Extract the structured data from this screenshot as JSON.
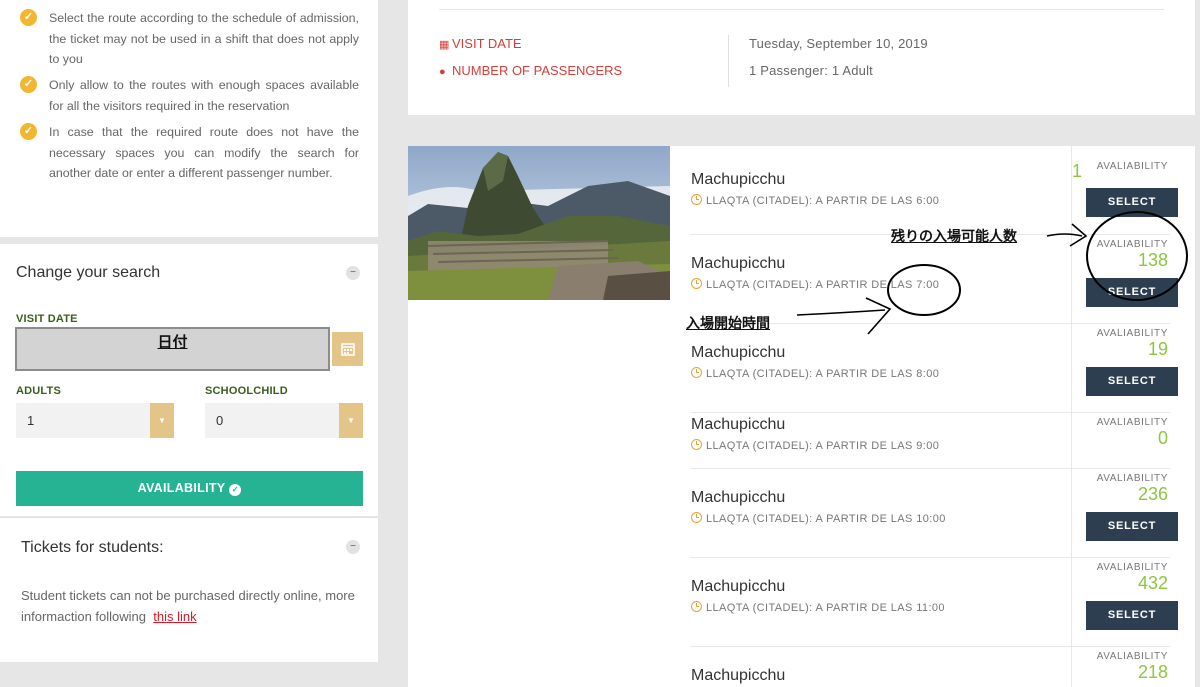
{
  "rules": [
    "Select the route according to the schedule of admission, the ticket may not be used in a shift that does not apply to you",
    "Only allow to the routes with enough spaces available for all the visitors required in the reservation",
    "In case that the required route does not have the necessary spaces you can modify the search for another date or enter a different passenger number."
  ],
  "change_search": {
    "title": "Change your search",
    "visit_date_label": "VISIT DATE",
    "visit_date_value": "日付",
    "adults_label": "ADULTS",
    "adults_value": "1",
    "schoolchild_label": "SCHOOLCHILD",
    "schoolchild_value": "0",
    "availability_button": "AVAILABILITY"
  },
  "students": {
    "title": "Tickets for students:",
    "text": "Student tickets can not be purchased directly online, more informaction following",
    "link": "this link"
  },
  "summary": {
    "visit_date_label": "VISIT DATE",
    "visit_date_value": "Tuesday, September 10, 2019",
    "passengers_label": "NUMBER OF PASSENGERS",
    "passengers_value": "1 Passenger: 1 Adult"
  },
  "slots": [
    {
      "name": "Machupicchu",
      "schedule": "LLAQTA (CITADEL): A PARTIR DE LAS 6:00",
      "availability_label": "AVALIABILITY",
      "availability": "1",
      "select": "SELECT"
    },
    {
      "name": "Machupicchu",
      "schedule": "LLAQTA (CITADEL): A PARTIR DE LAS 7:00",
      "availability_label": "AVALIABILITY",
      "availability": "138",
      "select": "SELECT"
    },
    {
      "name": "Machupicchu",
      "schedule": "LLAQTA (CITADEL): A PARTIR DE LAS 8:00",
      "availability_label": "AVALIABILITY",
      "availability": "19",
      "select": "SELECT"
    },
    {
      "name": "Machupicchu",
      "schedule": "LLAQTA (CITADEL): A PARTIR DE LAS 9:00",
      "availability_label": "AVALIABILITY",
      "availability": "0",
      "select": ""
    },
    {
      "name": "Machupicchu",
      "schedule": "LLAQTA (CITADEL): A PARTIR DE LAS 10:00",
      "availability_label": "AVALIABILITY",
      "availability": "236",
      "select": "SELECT"
    },
    {
      "name": "Machupicchu",
      "schedule": "LLAQTA (CITADEL): A PARTIR DE LAS 11:00",
      "availability_label": "AVALIABILITY",
      "availability": "432",
      "select": "SELECT"
    },
    {
      "name": "Machupicchu",
      "schedule": "",
      "availability_label": "AVALIABILITY",
      "availability": "218",
      "select": ""
    }
  ],
  "annotations": {
    "remaining": "残りの入場可能人数",
    "start_time": "入場開始時間"
  },
  "colors": {
    "accent_green": "#25b394",
    "availability_green": "#8dc63f",
    "check_yellow": "#f2b730",
    "select_dark": "#2c3e50",
    "summary_red": "#d3403a"
  }
}
